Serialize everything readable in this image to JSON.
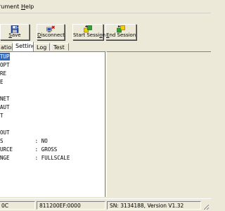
{
  "menu": {
    "instrument": {
      "pre": "",
      "mnemonic": "I",
      "post": "nstrument",
      "visible": "rument"
    },
    "help": {
      "pre": "",
      "mnemonic": "H",
      "post": "elp"
    }
  },
  "toolbar": {
    "save": {
      "pre": "",
      "mnemonic": "S",
      "post": "ave"
    },
    "disconnect": {
      "pre": "",
      "mnemonic": "D",
      "post": "isconnect"
    },
    "start_session": {
      "pre": "Start Sessi",
      "mnemonic": "o",
      "post": "n"
    },
    "end_session": {
      "pre": "",
      "mnemonic": "E",
      "post": "nd Session"
    }
  },
  "tabs": [
    {
      "label": "ation",
      "active": false
    },
    {
      "label": "Settings",
      "active": true
    },
    {
      "label": "Log",
      "active": false
    },
    {
      "label": "Test",
      "active": false
    }
  ],
  "text_lines": [
    {
      "text": "TUP",
      "highlight": true
    },
    {
      "text": "OPT",
      "highlight": false
    },
    {
      "text": "RE",
      "highlight": false
    },
    {
      "text": "E",
      "highlight": false
    },
    {
      "text": "",
      "highlight": false
    },
    {
      "text": "NET",
      "highlight": false
    },
    {
      "text": "AUT",
      "highlight": false
    },
    {
      "text": "T",
      "highlight": false
    },
    {
      "text": "",
      "highlight": false
    },
    {
      "text": "OUT",
      "highlight": false
    },
    {
      "text": "S          : NO",
      "highlight": false
    },
    {
      "text": "URCE       : GROSS",
      "highlight": false
    },
    {
      "text": "NGE        : FULLSCALE",
      "highlight": false
    }
  ],
  "status": {
    "panel1": "0C",
    "panel2": "811200EF:0000",
    "panel3": "SN: 3134188, Version V1.32"
  },
  "icons": {
    "save": "save-icon",
    "disconnect": "disconnect-icon",
    "start_session": "start-session-icon",
    "end_session": "end-session-icon",
    "grip": "resize-grip-icon"
  },
  "colors": {
    "window_bg": "#ece9d8",
    "selection": "#316ac5",
    "pane_bg": "#ffffff"
  }
}
